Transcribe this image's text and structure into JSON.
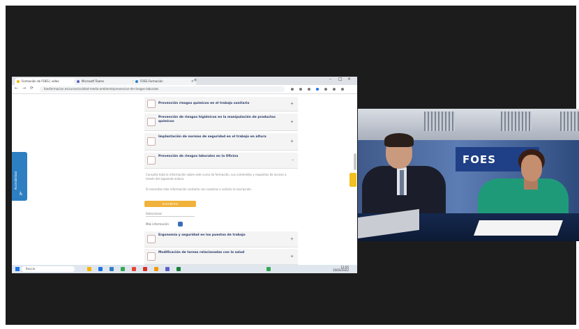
{
  "browser": {
    "tabs": [
      {
        "label": "Formación de FOES | vídeo"
      },
      {
        "label": "Microsoft Teams"
      },
      {
        "label": "FOES Formación"
      }
    ],
    "new_tab_symbol": "+",
    "tab_close_symbol": "×",
    "window_controls": [
      "–",
      "□",
      "×"
    ],
    "nav_icons": [
      "←",
      "→",
      "⟳"
    ],
    "url": "foesformacion.es/cursos/calidad-medio-ambiente/prevencion-de-riesgos-laborales"
  },
  "side_tab": {
    "label": "Accesibilidad",
    "icon": "♿"
  },
  "course_items": [
    {
      "label": "Prevención riesgos químicos en el trabajo sanitario",
      "expander": "+"
    },
    {
      "label": "Prevención de riesgos higiénicos en la manipulación de productos químicos",
      "expander": "+"
    },
    {
      "label": "Implantación de normas de seguridad en el trabajo en altura",
      "expander": "+"
    },
    {
      "label": "Prevención de riesgos laborales en la Oficina",
      "expander": "–"
    }
  ],
  "info_paragraphs": [
    "Consulta toda la información sobre este curso de formación, sus contenidos y requisitos de acceso a través del siguiente enlace.",
    "Si necesitas más información contacta con nosotros o solicita la inscripción."
  ],
  "action_button": "Inscribirme",
  "select_value": "Seleccionar",
  "section_label": "Más información",
  "lower_items": [
    {
      "label": "Ergonomía y seguridad en los puestos de trabajo",
      "expander": "+"
    },
    {
      "label": "Modificación de tareas relacionadas con la salud",
      "expander": "+"
    }
  ],
  "taskbar": {
    "search_placeholder": "Buscar",
    "tray_time": "12:05",
    "tray_date": "10/03/2022"
  },
  "camera": {
    "banner_text": "FOES"
  },
  "colors": {
    "accent_blue": "#2e7fc2",
    "accent_yellow": "#f0b23a",
    "brand_navy": "#1f3f86",
    "item_text": "#2a3a6a"
  }
}
